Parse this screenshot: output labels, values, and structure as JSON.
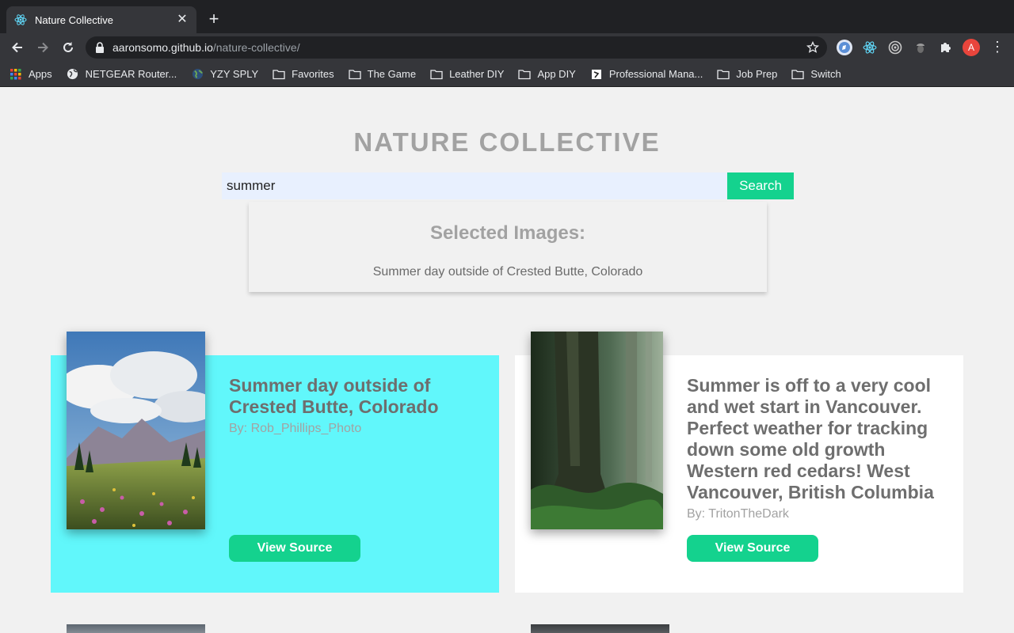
{
  "browser": {
    "tab_title": "Nature Collective",
    "url_host": "aaronsomo.github.io",
    "url_path": "/nature-collective/",
    "avatar_letter": "A",
    "bookmarks": [
      {
        "label": "Apps",
        "icon": "apps-grid-icon"
      },
      {
        "label": "NETGEAR Router...",
        "icon": "globe-icon"
      },
      {
        "label": "YZY SPLY",
        "icon": "earth-icon"
      },
      {
        "label": "Favorites",
        "icon": "folder-icon"
      },
      {
        "label": "The Game",
        "icon": "folder-icon"
      },
      {
        "label": "Leather DIY",
        "icon": "folder-icon"
      },
      {
        "label": "App DIY",
        "icon": "folder-icon"
      },
      {
        "label": "Professional Mana...",
        "icon": "page-icon"
      },
      {
        "label": "Job Prep",
        "icon": "folder-icon"
      },
      {
        "label": "Switch",
        "icon": "folder-icon"
      }
    ]
  },
  "page": {
    "title": "NATURE COLLECTIVE",
    "search_value": "summer",
    "search_button": "Search",
    "selected_heading": "Selected Images:",
    "selected_items": [
      "Summer day outside of Crested Butte, Colorado"
    ]
  },
  "cards": [
    {
      "title": "Summer day outside of Crested Butte, Colorado",
      "author": "By: Rob_Phillips_Photo",
      "button": "View Source",
      "selected": true
    },
    {
      "title": "Summer is off to a very cool and wet start in Vancouver. Perfect weather for tracking down some old growth Western red cedars! West Vancouver, British Columbia",
      "author": "By: TritonTheDark",
      "button": "View Source",
      "selected": false
    }
  ],
  "colors": {
    "accent": "#14d28e",
    "selected_card": "#61f7fb",
    "title_gray": "#a2a2a2"
  }
}
